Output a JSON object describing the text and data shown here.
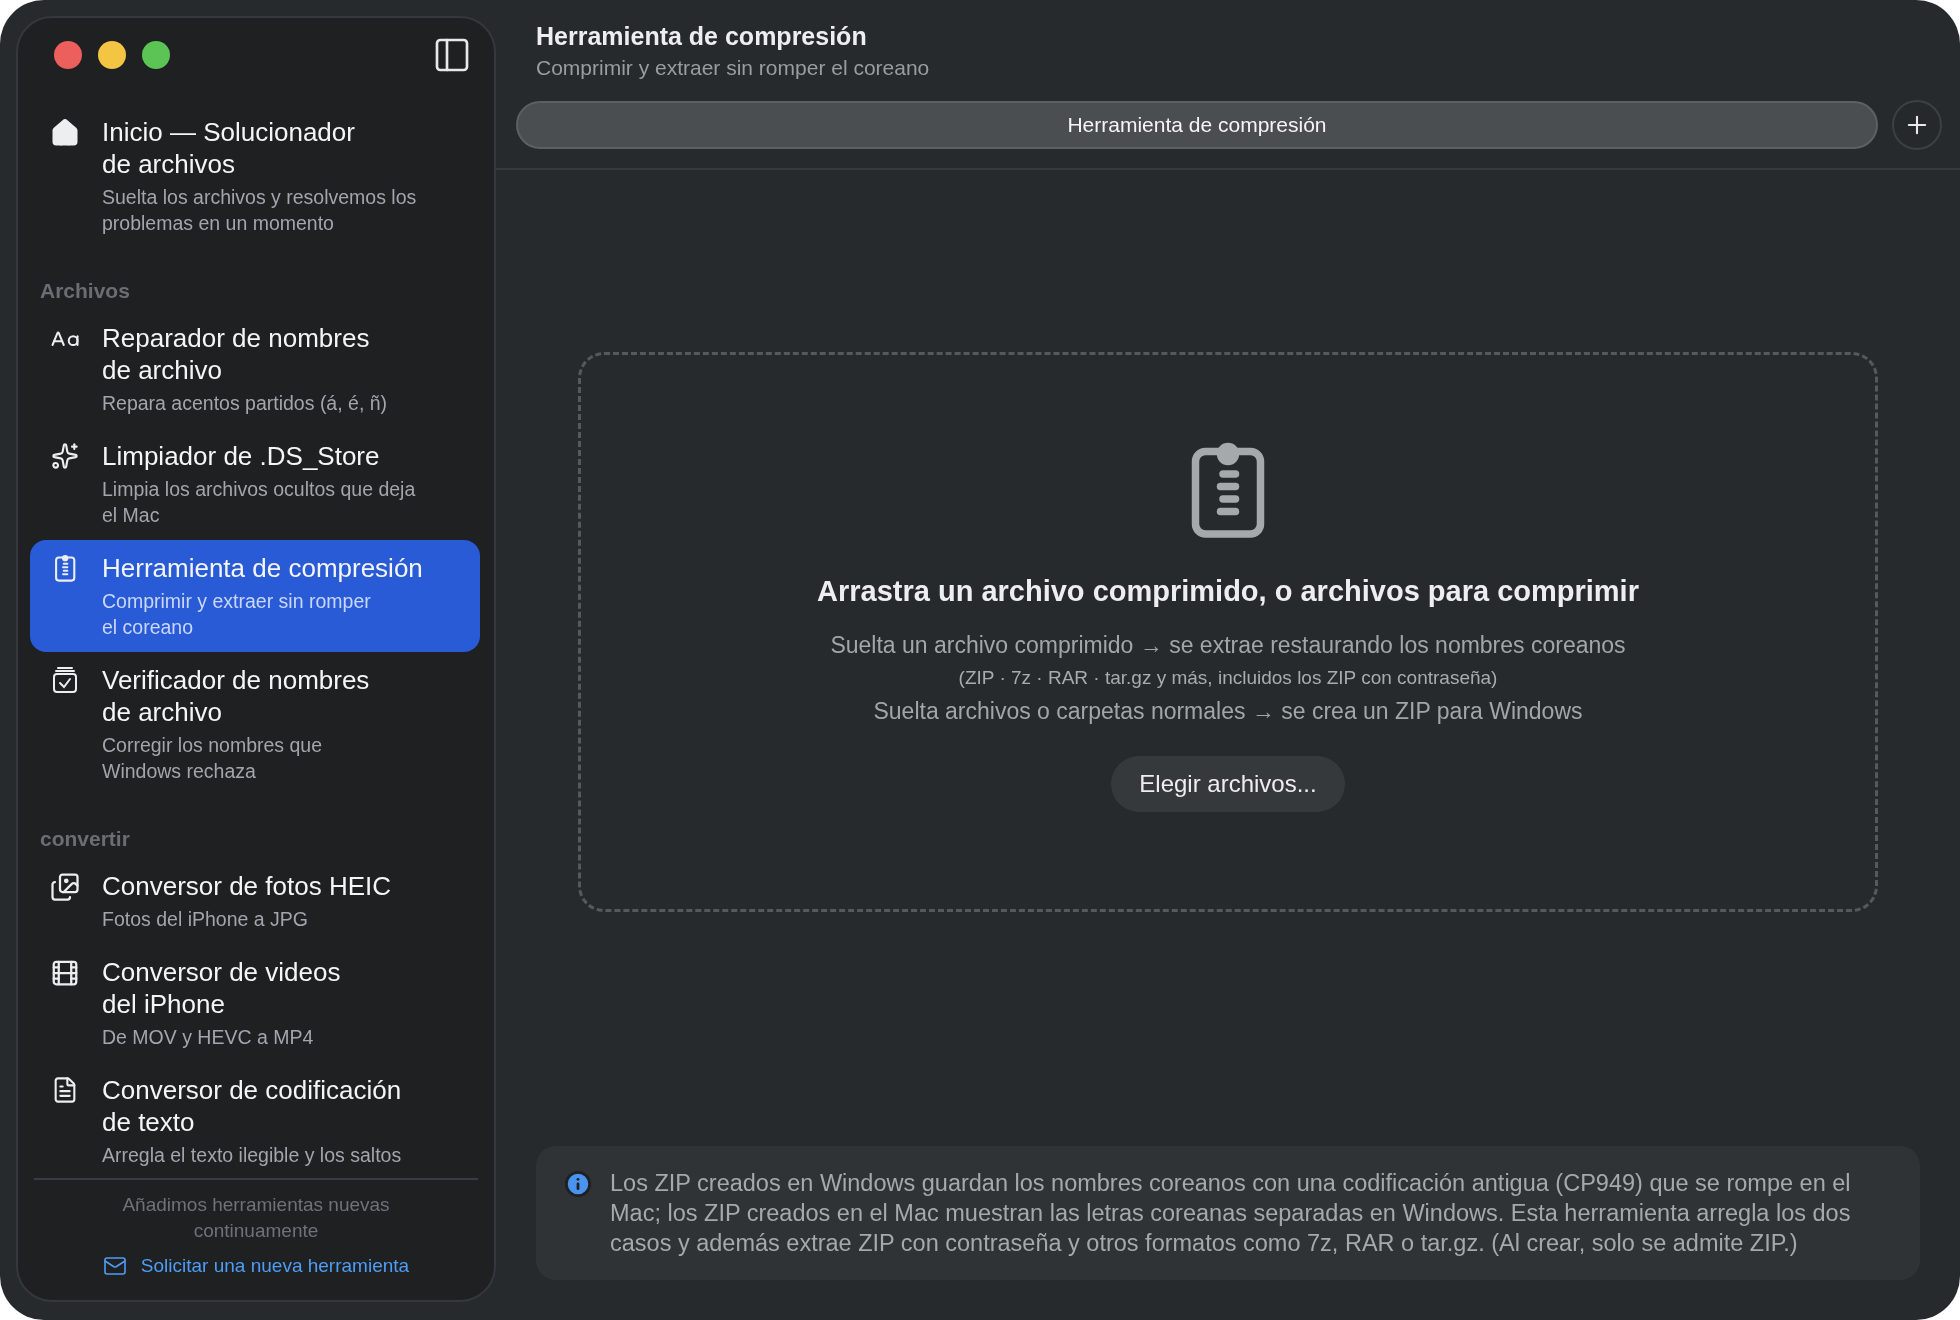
{
  "sidebar": {
    "home": {
      "title": "Inicio — Solucionador\nde archivos",
      "subtitle": "Suelta los archivos y resolvemos los\nproblemas en un momento",
      "selected": false
    },
    "sections": [
      {
        "heading": "Archivos",
        "items": [
          {
            "title": "Reparador de nombres\nde archivo",
            "subtitle": "Repara acentos partidos (á, é, ñ)",
            "selected": false
          },
          {
            "title": "Limpiador de .DS_Store",
            "subtitle": "Limpia los archivos ocultos que deja\nel Mac",
            "selected": false
          },
          {
            "title": "Herramienta de compresión",
            "subtitle": "Comprimir y extraer sin romper\nel coreano",
            "selected": true
          },
          {
            "title": "Verificador de nombres\nde archivo",
            "subtitle": "Corregir los nombres que\nWindows rechaza",
            "selected": false
          }
        ]
      },
      {
        "heading": "convertir",
        "items": [
          {
            "title": "Conversor de fotos HEIC",
            "subtitle": "Fotos del iPhone a JPG",
            "selected": false
          },
          {
            "title": "Conversor de videos\ndel iPhone",
            "subtitle": "De MOV y HEVC a MP4",
            "selected": false
          },
          {
            "title": "Conversor de codificación\nde texto",
            "subtitle": "Arregla el texto ilegible y los saltos",
            "selected": false
          }
        ]
      }
    ],
    "footer": {
      "note": "Añadimos herramientas nuevas\ncontinuamente",
      "link": "Solicitar una nueva herramienta"
    }
  },
  "header": {
    "title": "Herramienta de compresión",
    "subtitle": "Comprimir y extraer sin romper el coreano"
  },
  "tabs": [
    {
      "label": "Herramienta de compresión",
      "selected": true
    }
  ],
  "drop_zone": {
    "heading": "Arrastra un archivo comprimido, o archivos para comprimir",
    "lines": [
      {
        "text": "Suelta un archivo comprimido → se extrae restaurando los nombres coreanos",
        "kind": "main"
      },
      {
        "text": "(ZIP · 7z · RAR · tar.gz y más, incluidos los ZIP con contraseña)",
        "kind": "note"
      },
      {
        "text": "Suelta archivos o carpetas normales → se crea un ZIP para Windows",
        "kind": "main"
      }
    ],
    "button": "Elegir archivos..."
  },
  "info": "Los ZIP creados en Windows guardan los nombres coreanos con una codificación antigua (CP949) que se rompe en el Mac; los ZIP creados en el Mac muestran las letras coreanas separadas en Windows. Esta herramienta arregla los dos casos y además extrae ZIP con contraseña y otros formatos como 7z, RAR o tar.gz. (Al crear, solo se admite ZIP.)"
}
